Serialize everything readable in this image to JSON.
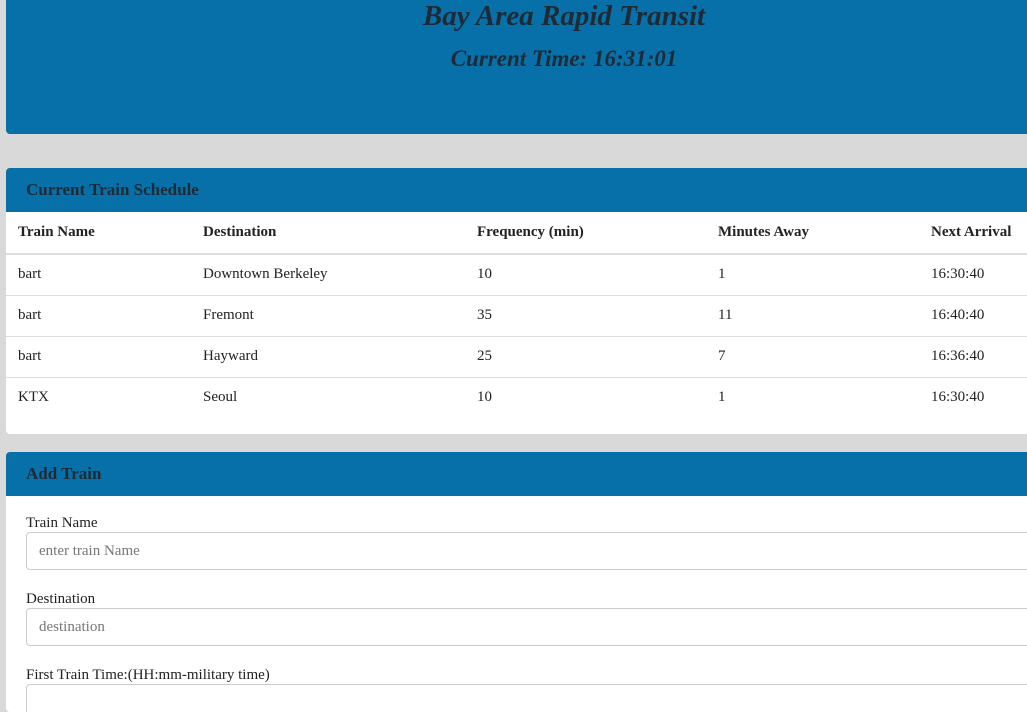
{
  "header": {
    "title": "Bay Area Rapid Transit",
    "current_time": "Current Time: 16:31:01"
  },
  "schedule": {
    "heading": "Current Train Schedule",
    "columns": [
      "Train Name",
      "Destination",
      "Frequency (min)",
      "Minutes Away",
      "Next Arrival"
    ],
    "rows": [
      [
        "bart",
        "Downtown Berkeley",
        "10",
        "1",
        "16:30:40"
      ],
      [
        "bart",
        "Fremont",
        "35",
        "11",
        "16:40:40"
      ],
      [
        "bart",
        "Hayward",
        "25",
        "7",
        "16:36:40"
      ],
      [
        "KTX",
        "Seoul",
        "10",
        "1",
        "16:30:40"
      ]
    ]
  },
  "add_train": {
    "heading": "Add Train",
    "fields": [
      {
        "label": "Train Name",
        "placeholder": "enter train Name",
        "value": ""
      },
      {
        "label": "Destination",
        "placeholder": "destination",
        "value": ""
      },
      {
        "label": "First Train Time:(HH:mm-military time)",
        "placeholder": "",
        "value": ""
      }
    ]
  }
}
